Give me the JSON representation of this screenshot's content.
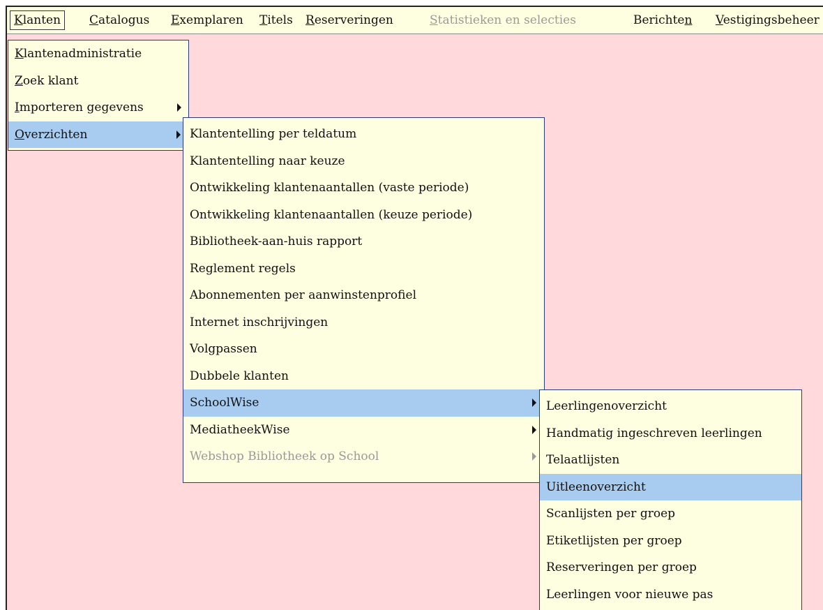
{
  "menubar": {
    "items": [
      {
        "pre": "",
        "key": "K",
        "post": "lanten"
      },
      {
        "pre": "",
        "key": "C",
        "post": "atalogus"
      },
      {
        "pre": "",
        "key": "E",
        "post": "xemplaren"
      },
      {
        "pre": "",
        "key": "T",
        "post": "itels"
      },
      {
        "pre": "",
        "key": "R",
        "post": "eserveringen"
      },
      {
        "pre": "",
        "key": "S",
        "post": "tatistieken en selecties"
      },
      {
        "pre": "Berichte",
        "key": "n",
        "post": ""
      },
      {
        "pre": "",
        "key": "V",
        "post": "estigingsbeheer"
      }
    ]
  },
  "klanten_menu": {
    "items": [
      {
        "pre": "",
        "key": "K",
        "post": "lantenadministratie"
      },
      {
        "pre": "",
        "key": "Z",
        "post": "oek klant"
      },
      {
        "pre": "",
        "key": "I",
        "post": "mporteren gegevens"
      },
      {
        "pre": "",
        "key": "O",
        "post": "verzichten"
      }
    ]
  },
  "overzichten_menu": {
    "items": [
      "Klantentelling per teldatum",
      "Klantentelling naar keuze",
      "Ontwikkeling klantenaantallen (vaste periode)",
      "Ontwikkeling klantenaantallen (keuze periode)",
      "Bibliotheek-aan-huis rapport",
      "Reglement regels",
      "Abonnementen per aanwinstenprofiel",
      "Internet inschrijvingen",
      "Volgpassen",
      "Dubbele klanten",
      "SchoolWise",
      "MediatheekWise",
      "Webshop Bibliotheek op School"
    ]
  },
  "schoolwise_menu": {
    "items": [
      "Leerlingenoverzicht",
      "Handmatig ingeschreven leerlingen",
      "Telaatlijsten",
      "Uitleenoverzicht",
      "Scanlijsten per groep",
      "Etiketlijsten per groep",
      "Reserveringen per groep",
      "Leerlingen voor nieuwe pas"
    ]
  },
  "colors": {
    "menu_bg": "#fefee0",
    "highlight": "#a8ccf0",
    "workspace": "#ffd9dc",
    "disabled_text": "#9a9a9a",
    "menu_border": "#2a3a7a"
  }
}
